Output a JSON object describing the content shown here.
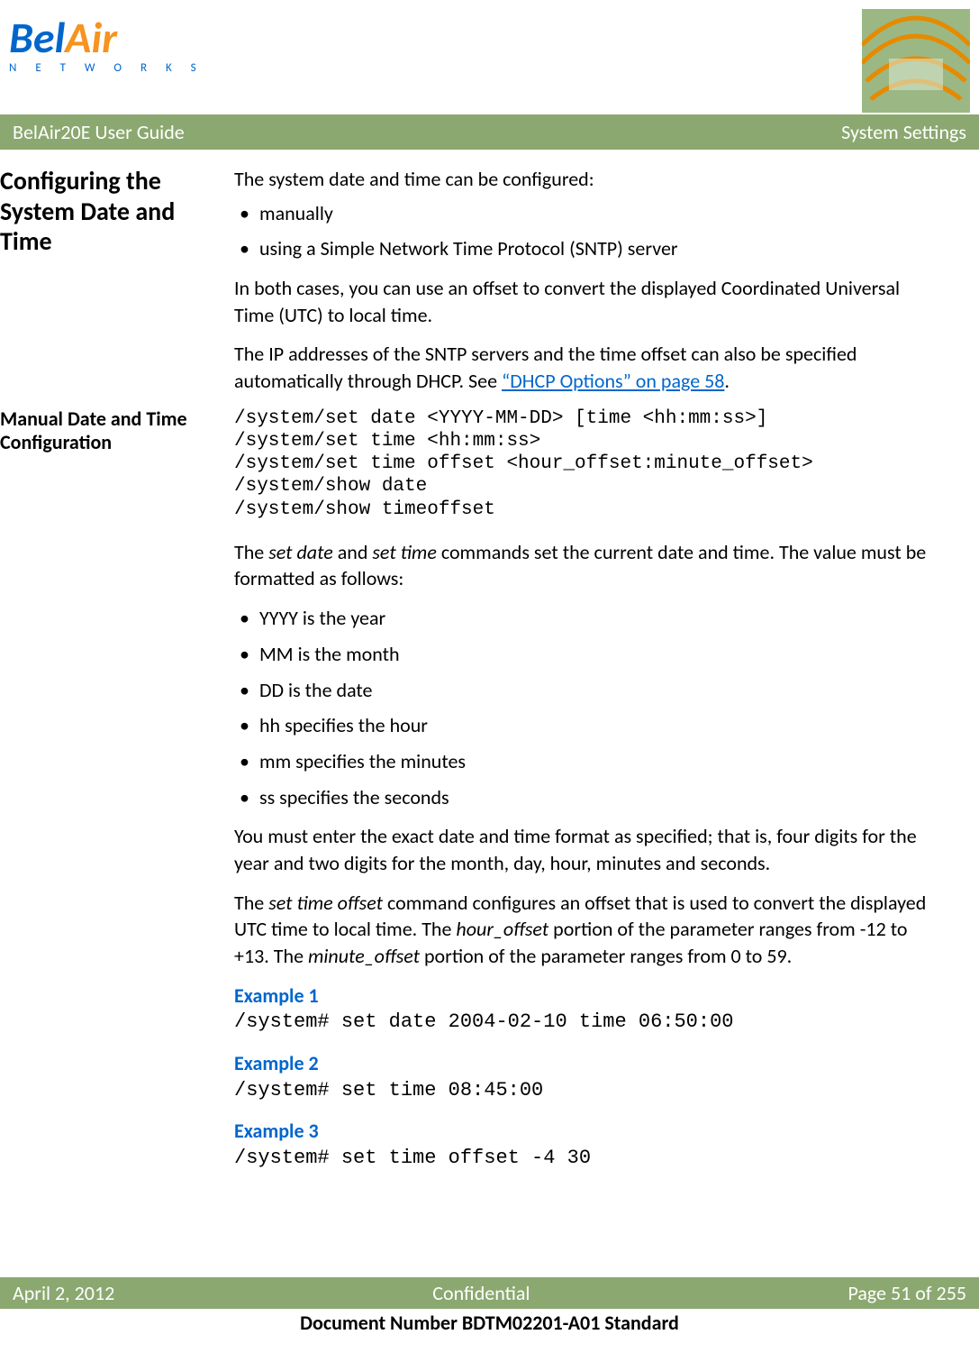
{
  "header": {
    "logo_primary_1": "Bel",
    "logo_primary_2": "Air",
    "logo_secondary": "N E T W O R K S",
    "title_left": "BelAir20E User Guide",
    "title_right": "System Settings"
  },
  "section1": {
    "heading": "Configuring the System Date and Time",
    "intro": "The system date and time can be configured:",
    "bullets": [
      "manually",
      "using a Simple Network Time Protocol (SNTP) server"
    ],
    "para2": "In both cases, you can use an offset to convert the displayed Coordinated Universal Time (UTC) to local time.",
    "para3_a": "The IP addresses of the SNTP servers and the time offset can also be specified automatically through DHCP. See ",
    "para3_link": "“DHCP Options” on page 58",
    "para3_b": "."
  },
  "section2": {
    "heading": "Manual Date and Time Configuration",
    "code": "/system/set date <YYYY-MM-DD> [time <hh:mm:ss>]\n/system/set time <hh:mm:ss>\n/system/set time offset <hour_offset:minute_offset>\n/system/show date\n/system/show timeoffset",
    "para1_a": "The ",
    "para1_i1": "set date",
    "para1_b": " and ",
    "para1_i2": "set time",
    "para1_c": " commands set the current date and time. The value must be formatted as follows:",
    "fmt_bullets": [
      "YYYY is the year",
      "MM is the month",
      "DD is the date",
      "hh specifies the hour",
      "mm specifies the minutes",
      "ss specifies the seconds"
    ],
    "para2": "You must enter the exact date and time format as specified; that is, four digits for the year and two digits for the month, day, hour, minutes and seconds.",
    "para3_a": "The ",
    "para3_i1": "set time offset",
    "para3_b": " command configures an offset that is used to convert the displayed UTC time to local time. The ",
    "para3_i2": "hour_offset",
    "para3_c": " portion of the parameter ranges from -12 to +13. The ",
    "para3_i3": "minute_offset",
    "para3_d": " portion of the parameter ranges from 0 to 59.",
    "ex1_h": "Example 1",
    "ex1_c": "/system# set date 2004-02-10 time 06:50:00",
    "ex2_h": "Example 2",
    "ex2_c": "/system# set time 08:45:00",
    "ex3_h": "Example 3",
    "ex3_c": "/system# set time offset -4 30"
  },
  "footer": {
    "date": "April 2, 2012",
    "confidential": "Confidential",
    "page": "Page 51 of 255",
    "docnum": "Document Number BDTM02201-A01 Standard"
  }
}
